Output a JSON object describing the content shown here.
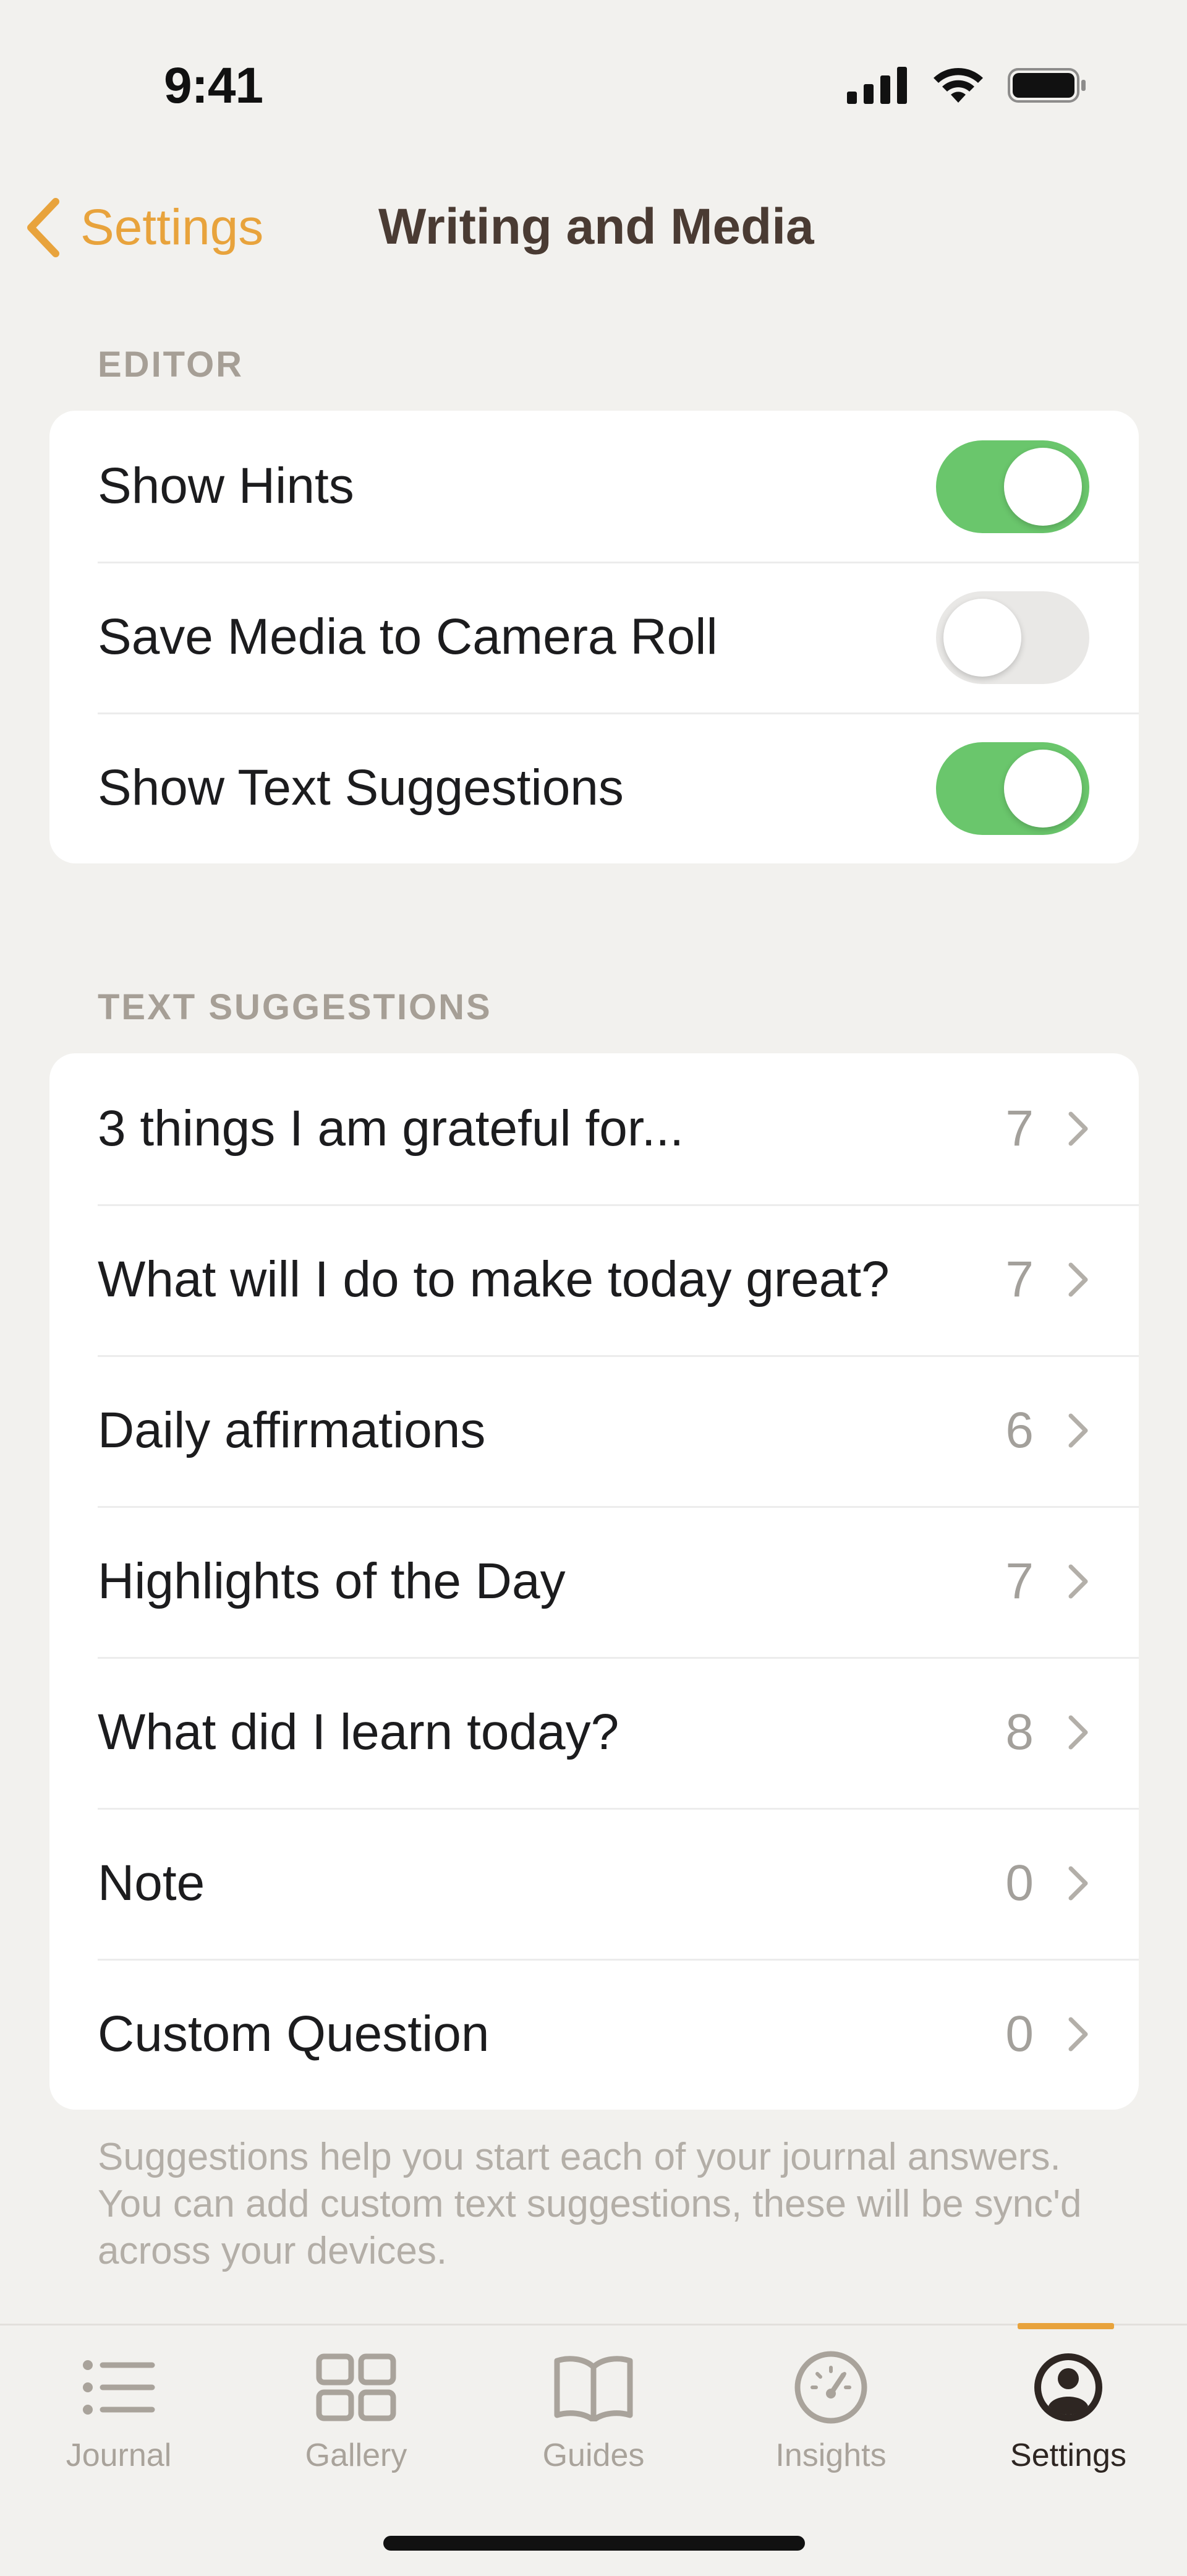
{
  "status_bar": {
    "time": "9:41"
  },
  "nav": {
    "back_label": "Settings",
    "title": "Writing and Media"
  },
  "editor": {
    "header": "EDITOR",
    "rows": [
      {
        "label": "Show Hints",
        "on": true
      },
      {
        "label": "Save Media to Camera Roll",
        "on": false
      },
      {
        "label": "Show Text Suggestions",
        "on": true
      }
    ]
  },
  "text_suggestions": {
    "header": "TEXT SUGGESTIONS",
    "rows": [
      {
        "label": "3 things I am grateful for...",
        "count": "7"
      },
      {
        "label": "What will I do to make today great?",
        "count": "7"
      },
      {
        "label": "Daily affirmations",
        "count": "6"
      },
      {
        "label": "Highlights of the Day",
        "count": "7"
      },
      {
        "label": "What did I learn today?",
        "count": "8"
      },
      {
        "label": "Note",
        "count": "0"
      },
      {
        "label": "Custom Question",
        "count": "0"
      }
    ],
    "footer": "Suggestions help you start each of your journal answers. You can add custom text suggestions, these will be sync'd across your devices."
  },
  "tabbar": {
    "tabs": [
      {
        "label": "Journal",
        "icon": "list-icon"
      },
      {
        "label": "Gallery",
        "icon": "grid-icon"
      },
      {
        "label": "Guides",
        "icon": "book-icon"
      },
      {
        "label": "Insights",
        "icon": "gauge-icon"
      },
      {
        "label": "Settings",
        "icon": "person-circle-icon"
      }
    ],
    "active": "Settings"
  },
  "colors": {
    "accent": "#e8a33c",
    "toggle_on": "#6ac66c",
    "background": "#f2f1ee"
  }
}
